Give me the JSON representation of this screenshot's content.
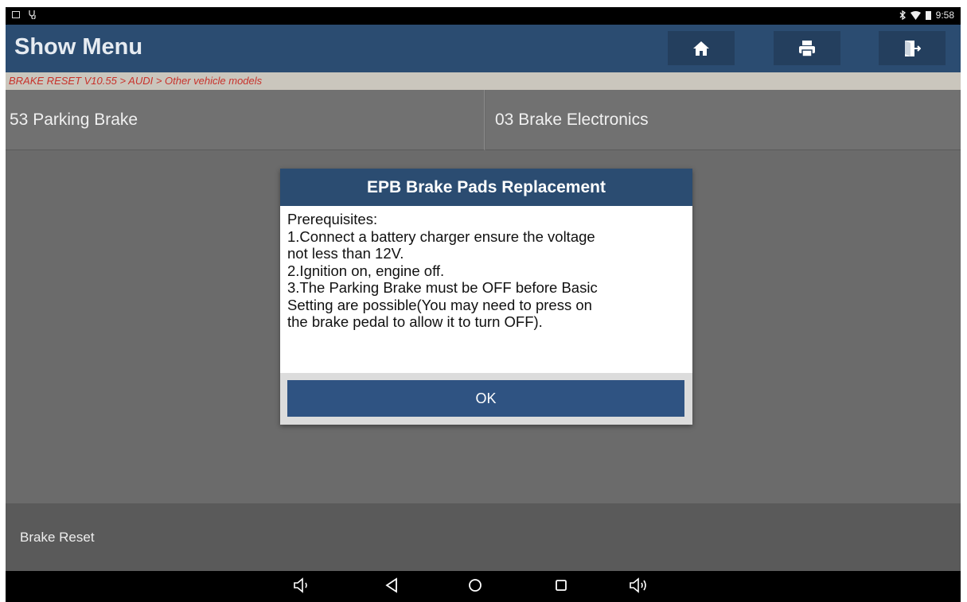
{
  "statusbar": {
    "time": "9:58"
  },
  "header": {
    "title": "Show Menu"
  },
  "breadcrumb": "BRAKE RESET V10.55 > AUDI > Other vehicle models",
  "menu": [
    {
      "label": "53 Parking Brake"
    },
    {
      "label": "03 Brake Electronics"
    }
  ],
  "footer": {
    "label": "Brake Reset"
  },
  "dialog": {
    "title": "EPB Brake Pads Replacement",
    "lines": [
      "Prerequisites:",
      "1.Connect a battery charger ensure the voltage",
      "not less than 12V.",
      "2.Ignition on, engine off.",
      "3.The Parking Brake must be OFF before Basic",
      "Setting are possible(You may need to press on",
      "the brake pedal to allow it to turn OFF)."
    ],
    "ok_label": "OK"
  },
  "icons": [
    "home-icon",
    "print-icon",
    "exit-icon",
    "volume-down-icon",
    "back-icon",
    "home-circle-icon",
    "recents-icon",
    "volume-up-icon"
  ],
  "colors": {
    "header": "#2b4c71",
    "breadcrumb_text": "#c8322b",
    "ok_button": "#2f5382"
  }
}
